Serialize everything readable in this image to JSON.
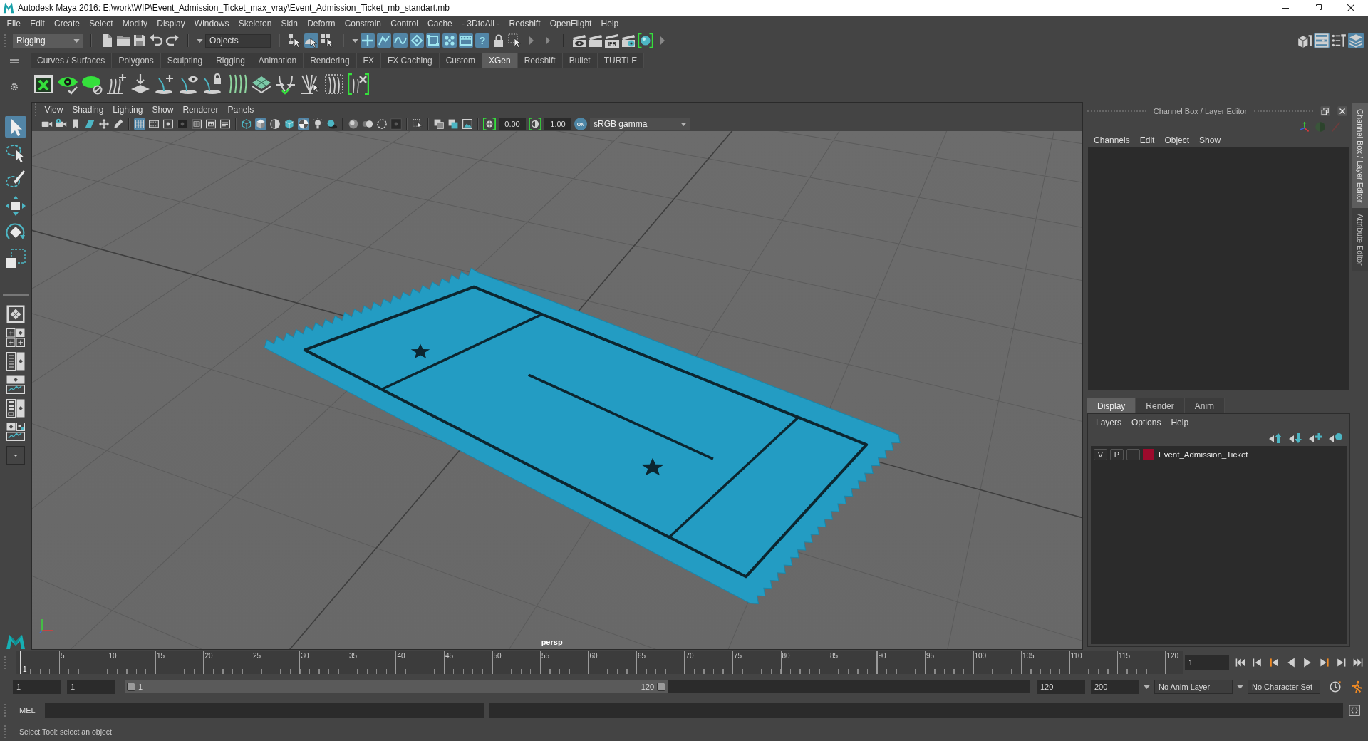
{
  "window": {
    "title": "Autodesk Maya 2016: E:\\work\\WIP\\Event_Admission_Ticket_max_vray\\Event_Admission_Ticket_mb_standart.mb"
  },
  "menu_bar": [
    "File",
    "Edit",
    "Create",
    "Select",
    "Modify",
    "Display",
    "Windows",
    "Skeleton",
    "Skin",
    "Deform",
    "Constrain",
    "Control",
    "Cache",
    "- 3DtoAll -",
    "Redshift",
    "OpenFlight",
    "Help"
  ],
  "status_line": {
    "menu_set": "Rigging",
    "selection_mask": "Objects",
    "selection_modes": [
      {
        "selected": false
      },
      {
        "selected": true
      },
      {
        "selected": false
      }
    ],
    "snap_toggles": [
      {
        "on": true
      },
      {
        "on": true
      },
      {
        "on": true
      },
      {
        "on": true
      },
      {
        "on": true
      },
      {
        "on": true
      },
      {
        "on": true
      },
      {
        "on": true,
        "label": "?"
      }
    ],
    "ipr_label": "IPR",
    "panel_toggles": [
      {
        "on": false
      },
      {
        "on": true
      },
      {
        "on": false
      },
      {
        "on": true
      }
    ]
  },
  "shelf": {
    "tabs": [
      {
        "label": "Curves / Surfaces",
        "selected": false
      },
      {
        "label": "Polygons",
        "selected": false
      },
      {
        "label": "Sculpting",
        "selected": false
      },
      {
        "label": "Rigging",
        "selected": false
      },
      {
        "label": "Animation",
        "selected": false
      },
      {
        "label": "Rendering",
        "selected": false
      },
      {
        "label": "FX",
        "selected": false
      },
      {
        "label": "FX Caching",
        "selected": false
      },
      {
        "label": "Custom",
        "selected": false
      },
      {
        "label": "XGen",
        "selected": true
      },
      {
        "label": "Redshift",
        "selected": false
      },
      {
        "label": "Bullet",
        "selected": false
      },
      {
        "label": "TURTLE",
        "selected": false
      }
    ]
  },
  "toolbox": {
    "tools": [
      {
        "selected": true
      },
      {
        "selected": false
      },
      {
        "selected": false
      },
      {
        "selected": false
      },
      {
        "selected": false
      },
      {
        "selected": false
      }
    ]
  },
  "viewport": {
    "menus": [
      "View",
      "Shading",
      "Lighting",
      "Show",
      "Renderer",
      "Panels"
    ],
    "gate_toggles": [
      {
        "on": true
      },
      {
        "on": false
      },
      {
        "on": false
      },
      {
        "on": false
      },
      {
        "on": false
      },
      {
        "on": false
      },
      {
        "on": false
      }
    ],
    "shading_toggles": [
      {
        "on": false
      },
      {
        "on": true
      },
      {
        "on": false
      },
      {
        "on": false
      },
      {
        "on": true
      },
      {
        "on": false
      },
      {
        "on": false
      }
    ],
    "exposure": "0.00",
    "gamma": "1.00",
    "color_management": {
      "on": true,
      "label": "ON"
    },
    "view_transform": "sRGB gamma",
    "camera": "persp"
  },
  "channel_box": {
    "title": "Channel Box / Layer Editor",
    "menus": [
      "Channels",
      "Edit",
      "Object",
      "Show"
    ]
  },
  "layer_editor": {
    "tabs": [
      {
        "label": "Display",
        "selected": true
      },
      {
        "label": "Render",
        "selected": false
      },
      {
        "label": "Anim",
        "selected": false
      }
    ],
    "menus": [
      "Layers",
      "Options",
      "Help"
    ],
    "layers": [
      {
        "visibility": "V",
        "playback": "P",
        "color": "#9c0a2c",
        "name": "Event_Admission_Ticket"
      }
    ]
  },
  "side_tabs": [
    {
      "label": "Channel Box / Layer Editor",
      "selected": true
    },
    {
      "label": "Attribute Editor",
      "selected": false
    }
  ],
  "time_slider": {
    "current_frame": "1",
    "ticks": [
      "5",
      "10",
      "15",
      "20",
      "25",
      "30",
      "35",
      "40",
      "45",
      "50",
      "55",
      "60",
      "65",
      "70",
      "75",
      "80",
      "85",
      "90",
      "95",
      "100",
      "105",
      "110",
      "115",
      "120"
    ],
    "frame_field": "1"
  },
  "range_slider": {
    "start_time": "1",
    "playback_start": "1",
    "level": 0.6,
    "range_start": "1",
    "range_end": "120",
    "playback_end": "120",
    "end_time": "200",
    "anim_layer": "No Anim Layer",
    "character_set": "No Character Set"
  },
  "command_line": {
    "language": "MEL"
  },
  "help_line": "Select Tool: select an object"
}
